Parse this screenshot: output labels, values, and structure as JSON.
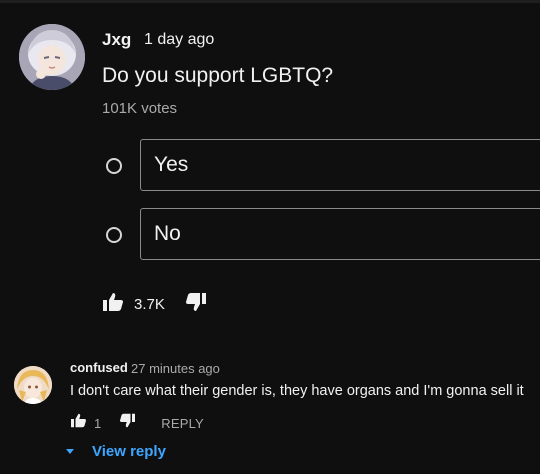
{
  "post": {
    "author": "Jxg",
    "time": "1 day ago",
    "question": "Do you support LGBTQ?",
    "votes": "101K votes",
    "options": [
      {
        "label": "Yes"
      },
      {
        "label": "No"
      }
    ],
    "like_count": "3.7K"
  },
  "comment": {
    "author": "confused",
    "time": "27 minutes ago",
    "text": "I don't care what their gender is, they have organs and I'm gonna sell it",
    "like_count": "1",
    "reply_label": "REPLY",
    "view_reply_label": "View reply"
  },
  "colors": {
    "background": "#0f0f0f",
    "link": "#3ea6ff",
    "secondary_text": "#aaaaaa"
  },
  "icons": [
    "thumbs-up-icon",
    "thumbs-down-icon",
    "radio-icon",
    "caret-down-icon"
  ]
}
